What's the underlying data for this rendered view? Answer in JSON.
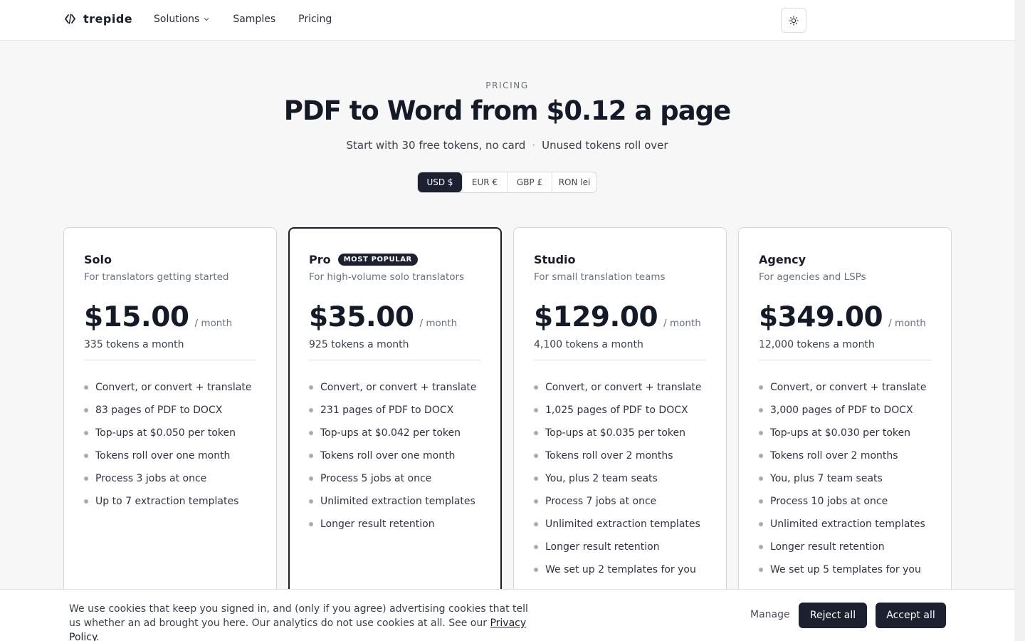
{
  "header": {
    "brand": "trepide",
    "nav": [
      {
        "label": "Solutions",
        "has_dropdown": true
      },
      {
        "label": "Samples"
      },
      {
        "label": "Pricing"
      }
    ],
    "theme_icon": "sun-icon"
  },
  "hero": {
    "eyebrow": "PRICING",
    "title": "PDF to Word from $0.12 a page",
    "sub_left": "Start with 30 free tokens, no card",
    "sub_sep": "·",
    "sub_right": "Unused tokens roll over"
  },
  "currency": {
    "options": [
      "USD $",
      "EUR €",
      "GBP £",
      "RON lei"
    ],
    "selected": "USD $"
  },
  "plans": [
    {
      "name": "Solo",
      "desc": "For translators getting started",
      "price": "$15.00",
      "period": "/ month",
      "tokens": "335 tokens a month",
      "features": [
        "Convert, or convert + translate",
        "83 pages of PDF to DOCX",
        "Top-ups at $0.050 per token",
        "Tokens roll over one month",
        "Process 3 jobs at once",
        "Up to 7 extraction templates"
      ]
    },
    {
      "name": "Pro",
      "badge": "MOST POPULAR",
      "desc": "For high-volume solo translators",
      "price": "$35.00",
      "period": "/ month",
      "tokens": "925 tokens a month",
      "features": [
        "Convert, or convert + translate",
        "231 pages of PDF to DOCX",
        "Top-ups at $0.042 per token",
        "Tokens roll over one month",
        "Process 5 jobs at once",
        "Unlimited extraction templates",
        "Longer result retention"
      ]
    },
    {
      "name": "Studio",
      "desc": "For small translation teams",
      "price": "$129.00",
      "period": "/ month",
      "tokens": "4,100 tokens a month",
      "features": [
        "Convert, or convert + translate",
        "1,025 pages of PDF to DOCX",
        "Top-ups at $0.035 per token",
        "Tokens roll over 2 months",
        "You, plus 2 team seats",
        "Process 7 jobs at once",
        "Unlimited extraction templates",
        "Longer result retention",
        "We set up 2 templates for you"
      ]
    },
    {
      "name": "Agency",
      "desc": "For agencies and LSPs",
      "price": "$349.00",
      "period": "/ month",
      "tokens": "12,000 tokens a month",
      "features": [
        "Convert, or convert + translate",
        "3,000 pages of PDF to DOCX",
        "Top-ups at $0.030 per token",
        "Tokens roll over 2 months",
        "You, plus 7 team seats",
        "Process 10 jobs at once",
        "Unlimited extraction templates",
        "Longer result retention",
        "We set up 5 templates for you"
      ]
    }
  ],
  "cookie": {
    "text": "We use cookies that keep you signed in, and (only if you agree) advertising cookies that tell us whether an ad brought you here. Our analytics do not use cookies at all. See our ",
    "link": "Privacy Policy",
    "end": ".",
    "manage": "Manage",
    "reject": "Reject all",
    "accept": "Accept all"
  },
  "colors": {
    "accent_dark": "#1c2030",
    "background": "#f7f7f8"
  }
}
